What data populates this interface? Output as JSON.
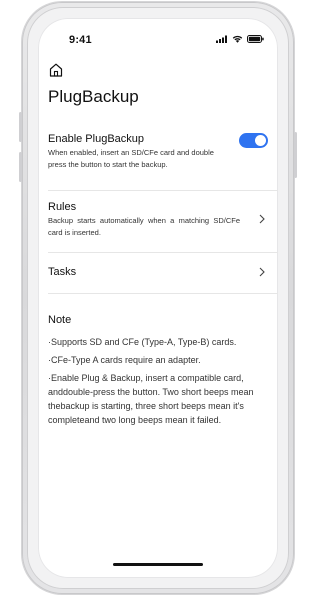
{
  "status_bar": {
    "time": "9:41",
    "icons": [
      "cellular-signal-icon",
      "wifi-icon",
      "battery-icon"
    ]
  },
  "header": {
    "home_icon": "home-icon",
    "title": "PlugBackup"
  },
  "enable_row": {
    "title": "Enable PlugBackup",
    "description": "When enabled, insert an SD/CFe card and double press the button to start the backup.",
    "toggle_on": true,
    "toggle_color": "#2f73f0"
  },
  "rules_row": {
    "title": "Rules",
    "description": "Backup starts automatically when a matching SD/CFe card is inserted."
  },
  "tasks_row": {
    "title": "Tasks"
  },
  "note": {
    "title": "Note",
    "lines": [
      "·Supports SD and CFe (Type-A, Type-B) cards.",
      "·CFe-Type A cards require an adapter.",
      "·Enable Plug & Backup, insert a compatible card, anddouble-press the button. Two short beeps mean thebackup is starting, three short beeps mean it's completeand two long beeps mean it failed."
    ]
  }
}
